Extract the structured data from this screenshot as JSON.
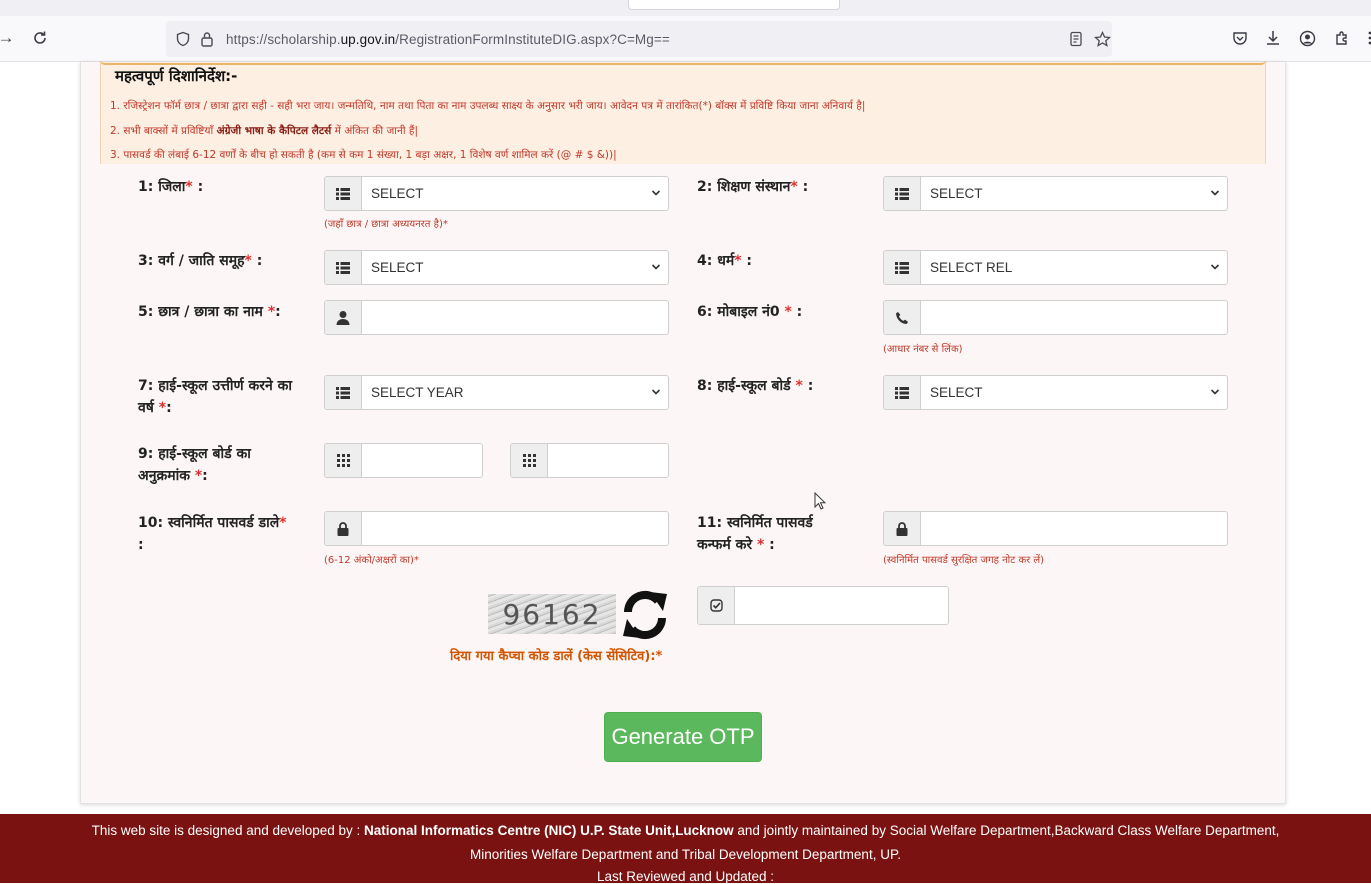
{
  "browser": {
    "url_prefix": "https://scholarship.",
    "url_domain": "up.gov.in",
    "url_path": "/RegistrationFormInstituteDIG.aspx?C=Mg=="
  },
  "guidelines": {
    "title": "महत्वपूर्ण दिशानिर्देश:-",
    "line1": "1. रजिस्ट्रेशन फॉर्म छात्र / छात्रा द्वारा सही - सही भरा जाय। जन्मतिथि, नाम तथा पिता का नाम उपलब्ध साक्ष्य के अनुसार भरी जाय। आवेदन पत्र में तारांकित(*) बॉक्स में प्रविष्टि किया जाना अनिवार्य है|",
    "line2_pre": "2. सभी बाक्सों में प्रविष्टियाँ ",
    "line2_bold": "अंग्रेजी भाषा के कैपिटल लैटर्स",
    "line2_post": " में अंकित की जानी हैं|",
    "line3": "3. पासवर्ड की लंबाई 6-12 वर्णों के बीच हो सकती है (कम से कम 1 संख्या, 1 बड़ा अक्षर, 1 विशेष वर्ण शामिल करें (@ # $ &))|"
  },
  "form": {
    "district": {
      "label": "1: जिला",
      "value": "SELECT",
      "hint": "(जहाँ छात्र / छात्रा अध्ययनरत है)*"
    },
    "institute": {
      "label": "2: शिक्षण संस्थान",
      "value": "SELECT"
    },
    "category": {
      "label": "3: वर्ग / जाति समूह",
      "value": "SELECT"
    },
    "religion": {
      "label": "4: धर्म",
      "value": "SELECT REL"
    },
    "student_name": {
      "label": "5: छात्र / छात्रा का नाम",
      "value": ""
    },
    "mobile": {
      "label": "6: मोबाइल नं0",
      "value": "",
      "hint": "(आधार नंबर से लिंक)"
    },
    "hs_year": {
      "label_1": "7: हाई-स्कूल उत्तीर्ण करने का",
      "label_2": "वर्ष",
      "value": "SELECT YEAR"
    },
    "hs_board": {
      "label": "8: हाई-स्कूल बोर्ड",
      "value": "SELECT"
    },
    "hs_roll": {
      "label_1": "9: हाई-स्कूल बोर्ड का",
      "label_2": "अनुक्रमांक",
      "value1": "",
      "value2": ""
    },
    "password": {
      "label_1": "10: स्वनिर्मित पासवर्ड डाले",
      "label_2": ":",
      "value": "",
      "hint": "(6-12 अंको/अक्षरों का)*"
    },
    "confirm_password": {
      "label_1": "11: स्वनिर्मित पासवर्ड",
      "label_2": "कन्फर्म करे",
      "value": "",
      "hint": "(स्वनिर्मित पासवर्ड सुरक्षित जगह नोट कर लें)"
    },
    "captcha": {
      "code": "96162",
      "label": "दिया गया कैप्चा कोड डालें (केस सेंसिटिव):*",
      "value": ""
    },
    "required_mark": "*",
    "colon": ":"
  },
  "generate_otp_label": "Generate OTP",
  "footer": {
    "line1_pre": "This web site is designed and developed by : ",
    "line1_bold": "National Informatics Centre (NIC) U.P. State Unit,Lucknow",
    "line1_post": " and jointly maintained by Social Welfare Department,Backward Class Welfare Department,",
    "line2": "Minorities Welfare Department and Tribal Development Department, UP.",
    "line3": "Last Reviewed and Updated :"
  },
  "colors": {
    "footer_bg": "#7a1212",
    "button_green": "#5cb85c",
    "hint_red": "#c0392b",
    "guide_bg": "#fdefe2"
  }
}
